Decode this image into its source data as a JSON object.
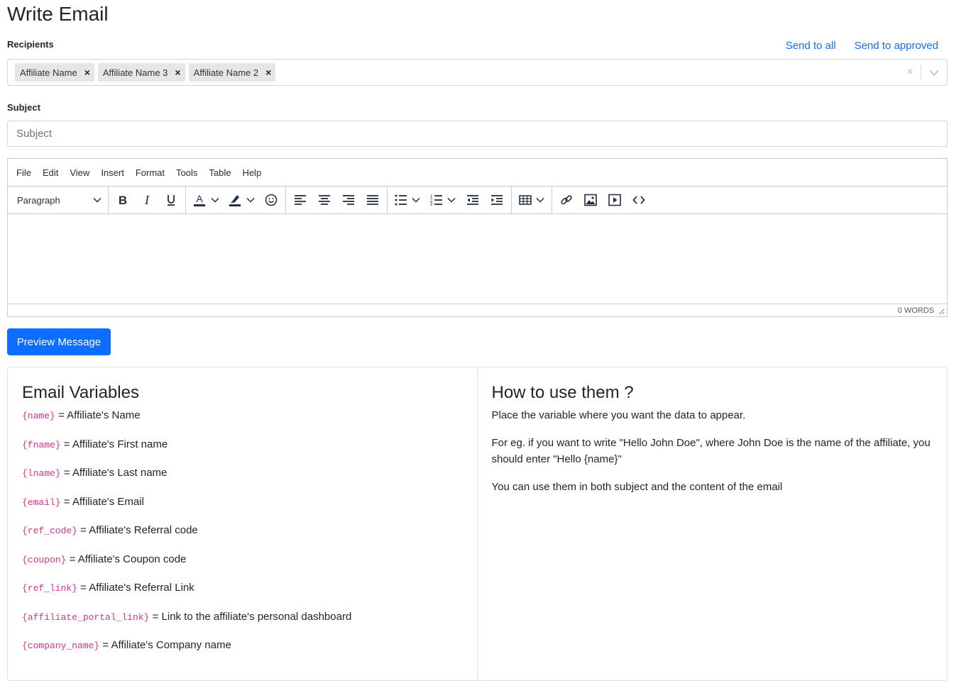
{
  "page": {
    "title": "Write Email"
  },
  "recipients": {
    "label": "Recipients",
    "send_all": "Send to all",
    "send_approved": "Send to approved",
    "chips": [
      "Affiliate Name",
      "Affiliate Name 3",
      "Affiliate Name 2"
    ],
    "remove_glyph": "×",
    "clear_glyph": "×"
  },
  "subject": {
    "label": "Subject",
    "placeholder": "Subject",
    "value": ""
  },
  "editor": {
    "menu": [
      "File",
      "Edit",
      "View",
      "Insert",
      "Format",
      "Tools",
      "Table",
      "Help"
    ],
    "block_format": "Paragraph",
    "word_count": "0 WORDS"
  },
  "preview_button": "Preview Message",
  "variables_card": {
    "title": "Email Variables",
    "items": [
      {
        "code": "{name}",
        "desc": " = Affiliate's Name"
      },
      {
        "code": "{fname}",
        "desc": " = Affiliate's First name"
      },
      {
        "code": "{lname}",
        "desc": " = Affiliate's Last name"
      },
      {
        "code": "{email}",
        "desc": " = Affiliate's Email"
      },
      {
        "code": "{ref_code}",
        "desc": " = Affiliate's Referral code"
      },
      {
        "code": "{coupon}",
        "desc": " = Affiliate's Coupon code"
      },
      {
        "code": "{ref_link}",
        "desc": " = Affiliate's Referral Link"
      },
      {
        "code": "{affiliate_portal_link}",
        "desc": " = Link to the affiliate's personal dashboard"
      },
      {
        "code": "{company_name}",
        "desc": " = Affiliate's Company name"
      }
    ]
  },
  "howto_card": {
    "title": "How to use them ?",
    "paragraphs": [
      "Place the variable where you want the data to appear.",
      "For eg. if you want to write \"Hello John Doe\", where John Doe is the name of the affiliate, you should enter \"Hello {name}\"",
      "You can use them in both subject and the content of the email"
    ]
  },
  "colors": {
    "primary": "#0d6efd",
    "code": "#d63384",
    "border": "#ced4da"
  }
}
